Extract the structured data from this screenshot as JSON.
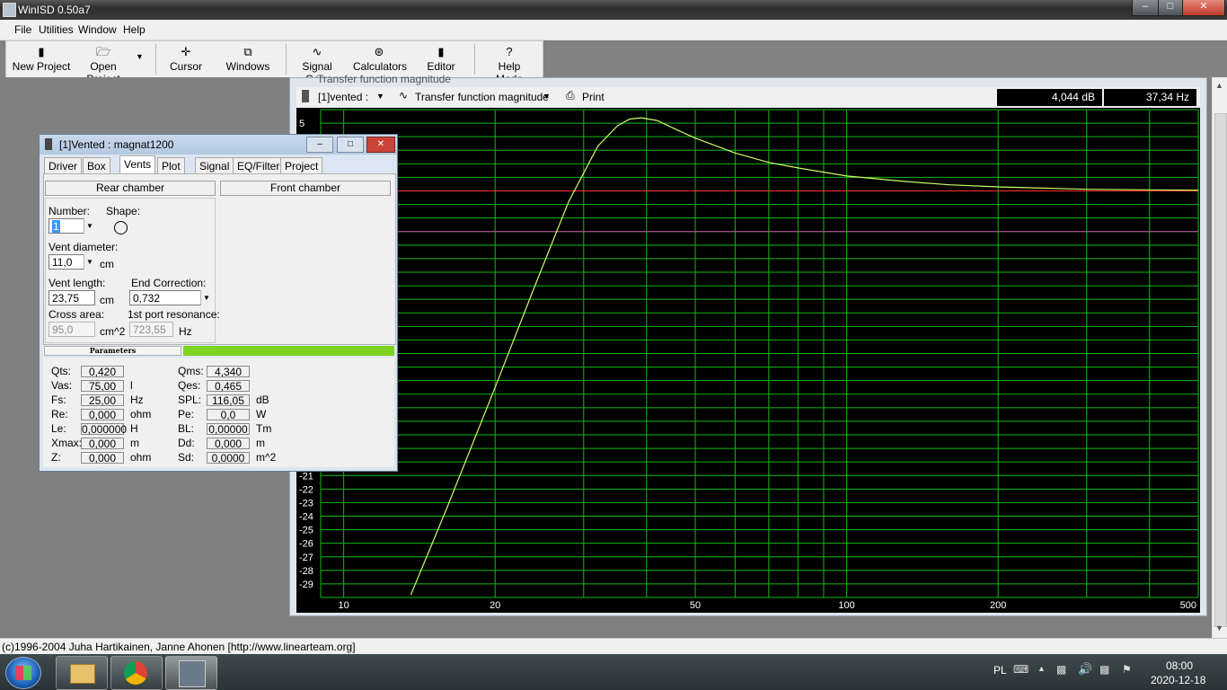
{
  "window": {
    "title": "WinISD 0.50a7",
    "min": "–",
    "max": "□",
    "close": "✕"
  },
  "menu": [
    "File",
    "Utilities",
    "Window",
    "Help"
  ],
  "toolbar": {
    "new_project": "New Project",
    "open_project": "Open Project",
    "cursor": "Cursor",
    "windows": "Windows",
    "signal_gen": "Signal Gen.",
    "calculators": "Calculators",
    "editor": "Editor",
    "help_mode": "Help Mode"
  },
  "graph": {
    "window_title": "Transfer function magnitude",
    "project_select": "[1]vented :",
    "plot_select": "Transfer function magnitude",
    "print": "Print",
    "readout_db": "4,044 dB",
    "readout_hz": "37,34 Hz"
  },
  "chart_data": {
    "type": "line",
    "x_scale": "log",
    "xlim": [
      9,
      500
    ],
    "ylim": [
      -30,
      6
    ],
    "x_tick_labels": [
      "10",
      "20",
      "50",
      "100",
      "200",
      "500"
    ],
    "y_tick_labels": [
      "5",
      "-21",
      "-22",
      "-23",
      "-24",
      "-25",
      "-26",
      "-27",
      "-28",
      "-29"
    ],
    "grid": true,
    "series": [
      {
        "color": "#ccff66",
        "x": [
          13.6,
          16,
          20,
          24,
          28,
          32,
          35,
          37,
          39,
          42,
          46,
          50,
          60,
          70,
          80,
          100,
          130,
          160,
          200,
          300,
          500
        ],
        "y": [
          -29.8,
          -23.5,
          -14.5,
          -7.0,
          -0.8,
          3.3,
          4.8,
          5.3,
          5.4,
          5.2,
          4.5,
          3.9,
          2.8,
          2.1,
          1.7,
          1.1,
          0.7,
          0.45,
          0.3,
          0.12,
          0.05
        ]
      }
    ],
    "reference_lines": [
      {
        "y": 0,
        "color": "#ff3030"
      },
      {
        "y": -3,
        "color": "#cc44aa"
      }
    ]
  },
  "dialog": {
    "title": "[1]Vented : magnat1200",
    "tabs": [
      "Driver",
      "Box",
      "Vents",
      "Plot",
      "Signal",
      "EQ/Filter",
      "Project"
    ],
    "active_tab": "Vents",
    "rear_chamber": "Rear chamber",
    "front_chamber": "Front chamber",
    "number_label": "Number:",
    "number_value": "1",
    "shape_label": "Shape:",
    "vent_diameter_label": "Vent diameter:",
    "vent_diameter_value": "11,0",
    "vent_diameter_unit": "cm",
    "vent_length_label": "Vent length:",
    "vent_length_value": "23,75",
    "vent_length_unit": "cm",
    "end_correction_label": "End Correction:",
    "end_correction_value": "0,732",
    "cross_area_label": "Cross area:",
    "cross_area_value": "95,0",
    "cross_area_unit": "cm^2",
    "port_res_label": "1st port resonance:",
    "port_res_value": "723,55",
    "port_res_unit": "Hz",
    "parameters_label": "Parameters",
    "params_left": [
      {
        "label": "Qts:",
        "value": "0,420",
        "unit": ""
      },
      {
        "label": "Vas:",
        "value": "75,00",
        "unit": "l"
      },
      {
        "label": "Fs:",
        "value": "25,00",
        "unit": "Hz"
      },
      {
        "label": "Re:",
        "value": "0,000",
        "unit": "ohm"
      },
      {
        "label": "Le:",
        "value": "0,000000",
        "unit": "H"
      },
      {
        "label": "Xmax:",
        "value": "0,000",
        "unit": "m"
      },
      {
        "label": "Z:",
        "value": "0,000",
        "unit": "ohm"
      }
    ],
    "params_right": [
      {
        "label": "Qms:",
        "value": "4,340",
        "unit": ""
      },
      {
        "label": "Qes:",
        "value": "0,465",
        "unit": ""
      },
      {
        "label": "SPL:",
        "value": "116,05",
        "unit": "dB"
      },
      {
        "label": "Pe:",
        "value": "0,0",
        "unit": "W"
      },
      {
        "label": "BL:",
        "value": "0,00000",
        "unit": "Tm"
      },
      {
        "label": "Dd:",
        "value": "0,000",
        "unit": "m"
      },
      {
        "label": "Sd:",
        "value": "0,0000",
        "unit": "m^2"
      }
    ]
  },
  "status": "(c)1996-2004 Juha Hartikainen, Janne Ahonen [http://www.linearteam.org]",
  "taskbar": {
    "lang": "PL",
    "time": "08:00",
    "date": "2020-12-18"
  }
}
